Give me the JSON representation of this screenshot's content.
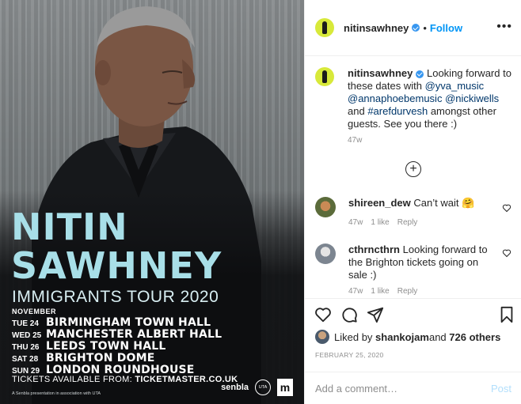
{
  "poster": {
    "title_line1": "NITIN",
    "title_line2": "SAWHNEY",
    "subtitle": "IMMIGRANTS TOUR 2020",
    "month": "NOVEMBER",
    "dates": [
      {
        "day": "TUE 24",
        "venue": "BIRMINGHAM TOWN HALL"
      },
      {
        "day": "WED 25",
        "venue": "MANCHESTER ALBERT HALL"
      },
      {
        "day": "THU 26",
        "venue": "LEEDS TOWN HALL"
      },
      {
        "day": "SAT 28",
        "venue": "BRIGHTON DOME"
      },
      {
        "day": "SUN 29",
        "venue": "LONDON ROUNDHOUSE"
      }
    ],
    "tickets_prefix": "TICKETS AVAILABLE FROM: ",
    "tickets_site": "TICKETMASTER.CO.UK",
    "fine_print": "A Senbla presentation in association with UTA",
    "logo_senbla": "senbla",
    "logo_uta": "UTA",
    "logo_m": "m"
  },
  "header": {
    "username": "nitinsawhney",
    "separator": "•",
    "follow_label": "Follow",
    "more_label": "•••"
  },
  "caption": {
    "username": "nitinsawhney",
    "text_1": "Looking forward to these dates with ",
    "mention_1": "@yva_music",
    "mention_2": "@annaphoebemusic",
    "mention_3": "@nickiwells",
    "text_2": " and ",
    "hashtag": "#arefdurvesh",
    "text_3": " amongst other guests. See you there :)",
    "time": "47w"
  },
  "comments": [
    {
      "username": "shireen_dew",
      "text": "Can’t wait 🤗",
      "time": "47w",
      "likes": "1 like",
      "reply": "Reply"
    },
    {
      "username": "cthrncthrn",
      "text": "Looking forward to the Brighton tickets going on sale :)",
      "time": "47w",
      "likes": "1 like",
      "reply": "Reply"
    }
  ],
  "likes": {
    "prefix": "Liked by ",
    "user": "shankojam",
    "middle": " and ",
    "count": "726 others"
  },
  "date": "FEBRUARY 25, 2020",
  "add_comment": {
    "placeholder": "Add a comment…",
    "post_label": "Post"
  },
  "colors": {
    "accent": "#0095f6",
    "poster_title": "#a8dfe8",
    "muted": "#8e8e8e"
  }
}
